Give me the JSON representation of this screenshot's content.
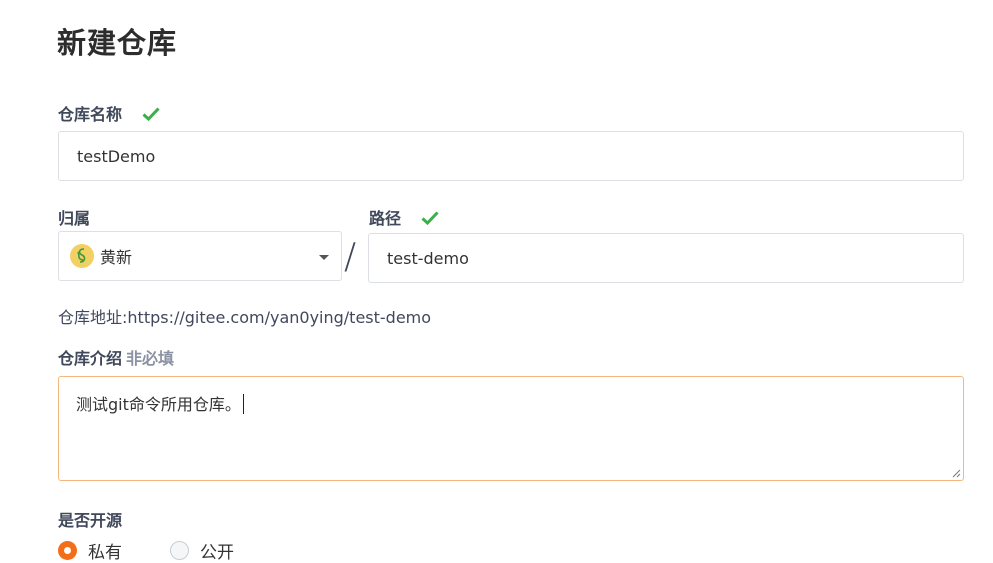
{
  "page": {
    "title": "新建仓库"
  },
  "repo_name": {
    "label": "仓库名称",
    "value": "testDemo",
    "valid_icon": "check-icon"
  },
  "owner": {
    "label": "归属",
    "value": "黄新",
    "avatar_glyph": "§"
  },
  "separator": "/",
  "path": {
    "label": "路径",
    "value": "test-demo",
    "valid_icon": "check-icon"
  },
  "repo_url": {
    "prefix": "仓库地址:",
    "url": "https://gitee.com/yan0ying/test-demo"
  },
  "description": {
    "label": "仓库介绍",
    "optional": "非必填",
    "value": "测试git命令所用仓库。"
  },
  "visibility": {
    "label": "是否开源",
    "options": [
      {
        "label": "私有",
        "checked": true
      },
      {
        "label": "公开",
        "checked": false
      }
    ]
  },
  "colors": {
    "accent": "#f26e18",
    "check": "#3bb04a",
    "focus_border": "#f4b77d"
  }
}
